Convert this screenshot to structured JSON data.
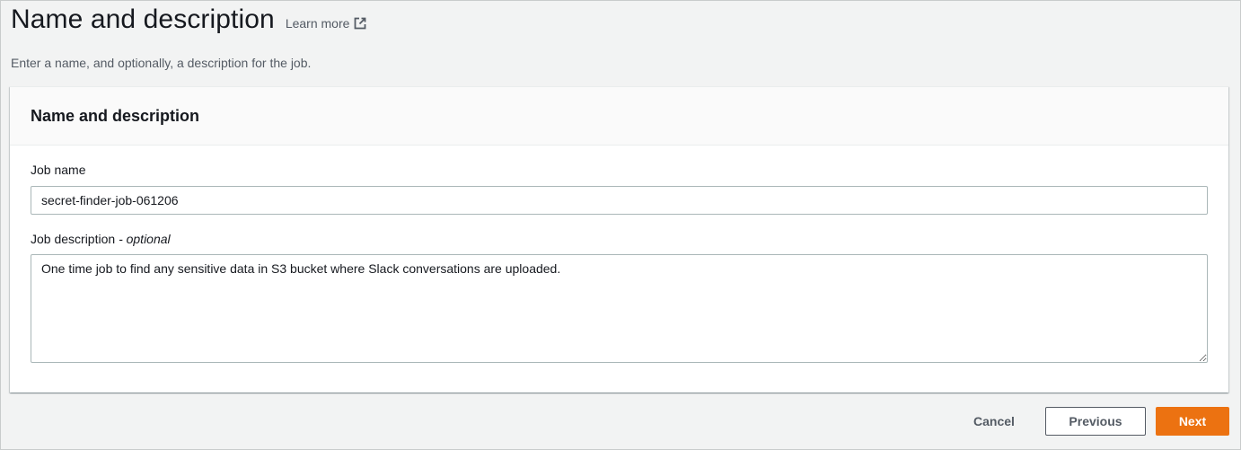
{
  "header": {
    "title": "Name and description",
    "learn_more": "Learn more",
    "learn_more_icon": "external-link-icon",
    "subtitle": "Enter a name, and optionally, a description for the job."
  },
  "panel": {
    "title": "Name and description",
    "job_name": {
      "label": "Job name",
      "value": "secret-finder-job-061206"
    },
    "job_description": {
      "label": "Job description",
      "optional": "- optional",
      "value": "One time job to find any sensitive data in S3 bucket where Slack conversations are uploaded."
    }
  },
  "footer": {
    "cancel": "Cancel",
    "previous": "Previous",
    "next": "Next"
  },
  "colors": {
    "primary_button": "#ec7211",
    "background": "#f2f3f3",
    "text": "#16191f",
    "secondary_text": "#545b64"
  }
}
